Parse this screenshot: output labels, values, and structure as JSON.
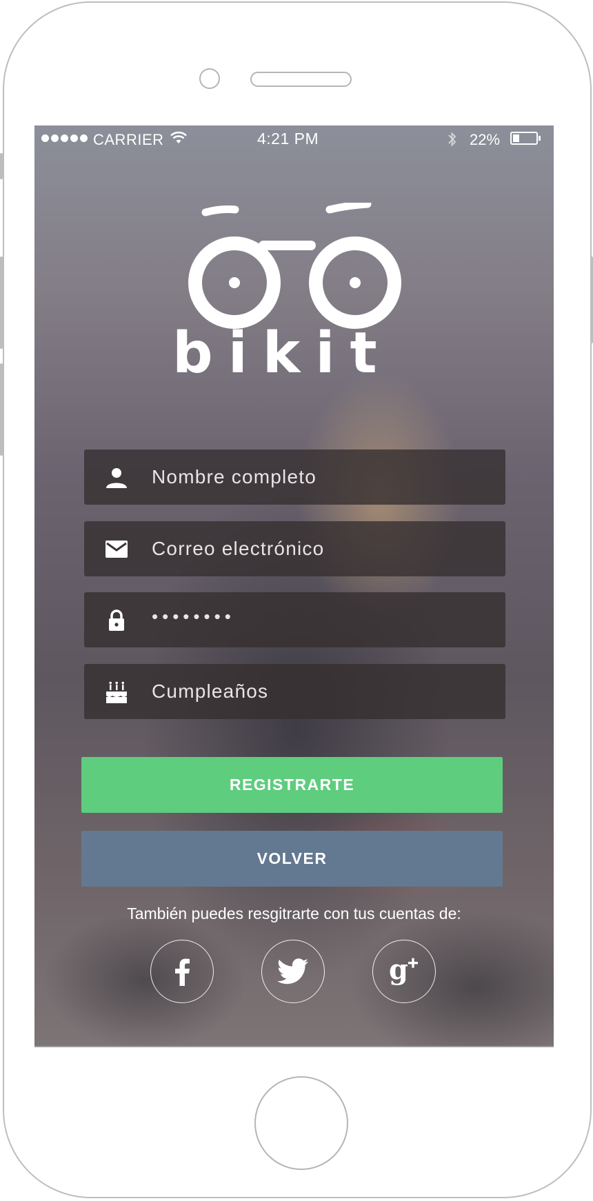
{
  "status_bar": {
    "carrier": "CARRIER",
    "time": "4:21 PM",
    "battery": "22%"
  },
  "brand": {
    "name": "bikit"
  },
  "form": {
    "full_name_placeholder": "Nombre completo",
    "email_placeholder": "Correo electrónico",
    "password_value": "••••••••",
    "birthday_placeholder": "Cumpleaños"
  },
  "actions": {
    "register_label": "REGISTRARTE",
    "back_label": "VOLVER"
  },
  "social": {
    "hint": "También puedes resgitrarte con tus cuentas de:",
    "providers": [
      "facebook",
      "twitter",
      "google-plus"
    ]
  },
  "colors": {
    "register": "#5ecd7e",
    "back": "#637991",
    "field_bg": "rgba(52,46,48,0.78)"
  },
  "icons": [
    "person-icon",
    "mail-icon",
    "lock-icon",
    "cake-icon",
    "facebook-icon",
    "twitter-icon",
    "google-plus-icon"
  ]
}
